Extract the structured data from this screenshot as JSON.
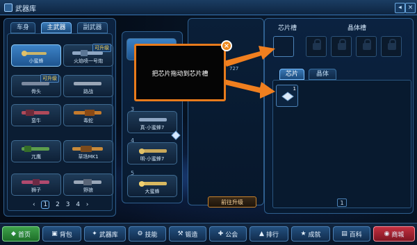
{
  "window": {
    "title": "武器库"
  },
  "left_tabs": [
    {
      "label": "车身"
    },
    {
      "label": "主武器"
    },
    {
      "label": "副武器"
    }
  ],
  "weapons": [
    {
      "label": "小蜜蜂",
      "badge": ""
    },
    {
      "label": "火焰喷一号炮",
      "badge": "可升级"
    },
    {
      "label": "骨头",
      "badge": "可升级"
    },
    {
      "label": "路战",
      "badge": ""
    },
    {
      "label": "蛮牛",
      "badge": ""
    },
    {
      "label": "毒蛇",
      "badge": ""
    },
    {
      "label": "兀鹰",
      "badge": ""
    },
    {
      "label": "草场MK1",
      "badge": ""
    },
    {
      "label": "狮子",
      "badge": ""
    },
    {
      "label": "野狼",
      "badge": ""
    }
  ],
  "pager": {
    "prev": "‹",
    "pages": [
      "1",
      "2",
      "3",
      "4"
    ],
    "current": "1",
    "next": "›"
  },
  "middle_list": [
    {
      "num": "3",
      "label": "真·小蜜蜂7"
    },
    {
      "num": "4",
      "label": "明·小蜜蜂7"
    },
    {
      "num": "5",
      "label": "大蜜蜂"
    }
  ],
  "detail": {
    "stat1": "727",
    "upgrade_button": "前往升级"
  },
  "popup": {
    "text": "把芯片拖动到芯片槽",
    "close": "×"
  },
  "chip_area": {
    "chip_slot_label": "芯片槽",
    "crystal_slot_label": "晶体槽",
    "tabs": [
      {
        "label": "芯片"
      },
      {
        "label": "晶体"
      }
    ],
    "inventory_count": "1",
    "page": "1"
  },
  "bottom_nav": [
    {
      "label": "首页"
    },
    {
      "label": "背包"
    },
    {
      "label": "武器库"
    },
    {
      "label": "技能"
    },
    {
      "label": "锻造"
    },
    {
      "label": "公会"
    },
    {
      "label": "排行"
    },
    {
      "label": "成就"
    },
    {
      "label": "百科"
    },
    {
      "label": "商城"
    }
  ],
  "colors": {
    "accent": "#e87b1c",
    "frame": "#2f5f8f",
    "home": "#2e8b3a",
    "shop": "#a11d2b"
  }
}
